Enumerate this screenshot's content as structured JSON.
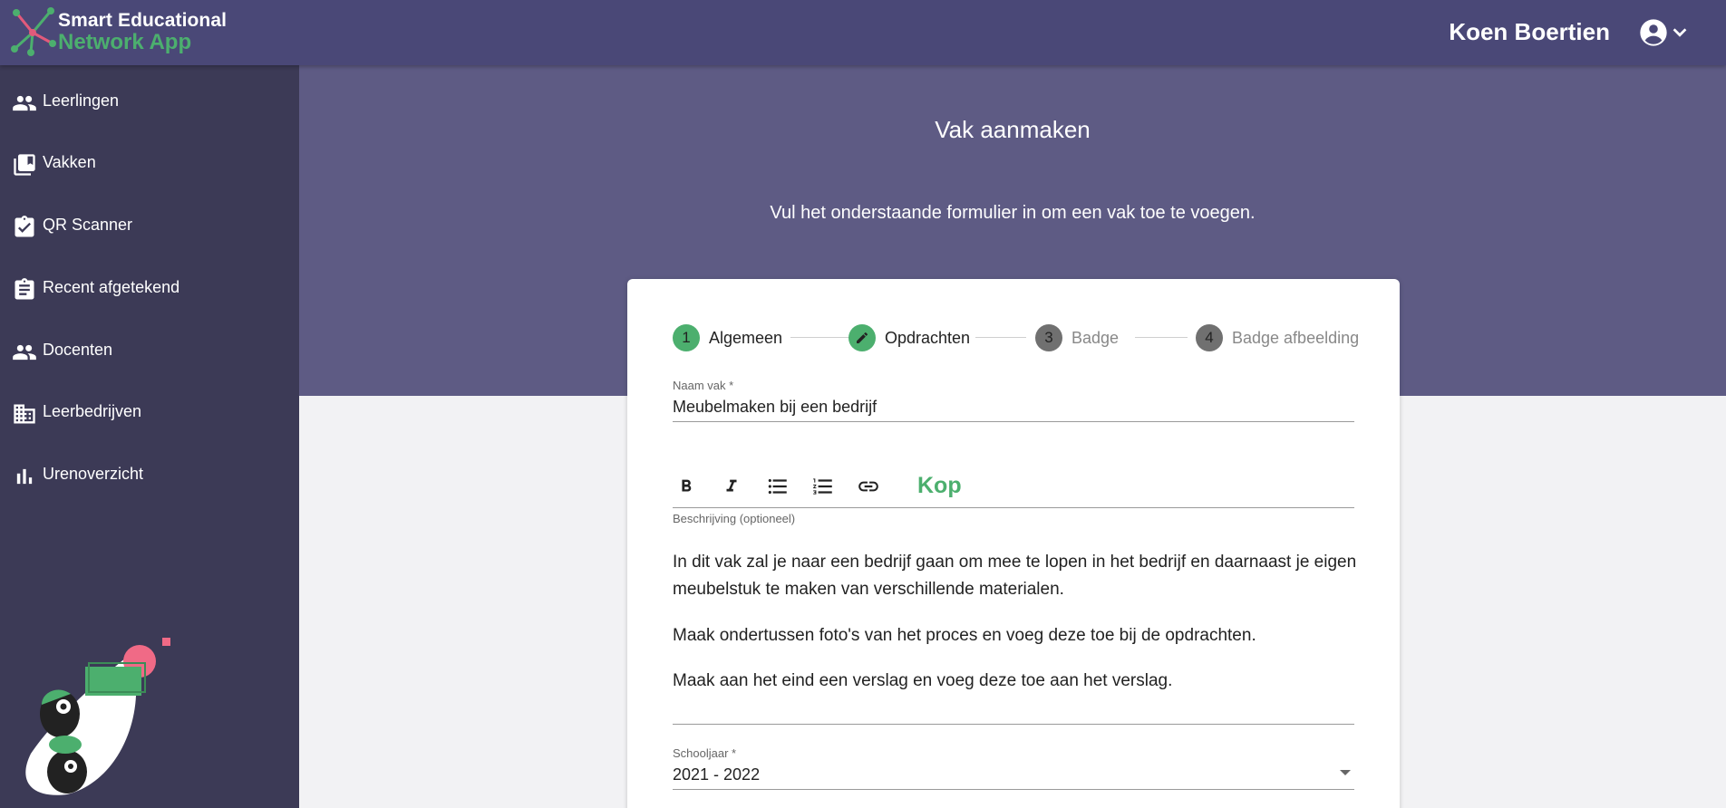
{
  "app": {
    "name_line1": "Smart Educational",
    "name_line2": "Network App",
    "user_name": "Koen Boertien"
  },
  "sidebar": {
    "items": [
      {
        "label": "Leerlingen",
        "icon": "people-icon"
      },
      {
        "label": "Vakken",
        "icon": "library-books-icon"
      },
      {
        "label": "QR Scanner",
        "icon": "clipboard-check-icon"
      },
      {
        "label": "Recent afgetekend",
        "icon": "clipboard-list-icon"
      },
      {
        "label": "Docenten",
        "icon": "people-icon"
      },
      {
        "label": "Leerbedrijven",
        "icon": "building-icon"
      },
      {
        "label": "Urenoverzicht",
        "icon": "bar-chart-icon"
      }
    ]
  },
  "page": {
    "title": "Vak aanmaken",
    "subtitle": "Vul het onderstaande formulier in om een vak toe te voegen."
  },
  "stepper": {
    "steps": [
      {
        "number": "1",
        "label": "Algemeen",
        "state": "active"
      },
      {
        "number": "",
        "label": "Opdrachten",
        "state": "editing"
      },
      {
        "number": "3",
        "label": "Badge",
        "state": "inactive"
      },
      {
        "number": "4",
        "label": "Badge afbeelding",
        "state": "inactive"
      }
    ]
  },
  "form": {
    "name": {
      "label": "Naam vak *",
      "value": "Meubelmaken bij een bedrijf"
    },
    "editor": {
      "heading_button": "Kop",
      "label": "Beschrijving (optioneel)",
      "paragraphs": [
        "In dit vak zal je naar een bedrijf gaan om mee te lopen in het bedrijf en daarnaast je eigen meubelstuk te maken van verschillende materialen.",
        "Maak ondertussen foto's van het proces en voeg deze toe bij de opdrachten.",
        "Maak aan het eind een verslag en voeg deze toe aan het verslag."
      ]
    },
    "school_year": {
      "label": "Schooljaar *",
      "value": "2021 - 2022"
    }
  },
  "colors": {
    "topbar": "#4a4877",
    "sidebar": "#3c3a56",
    "hero": "#5e5b84",
    "accent_green": "#4caf6e"
  }
}
